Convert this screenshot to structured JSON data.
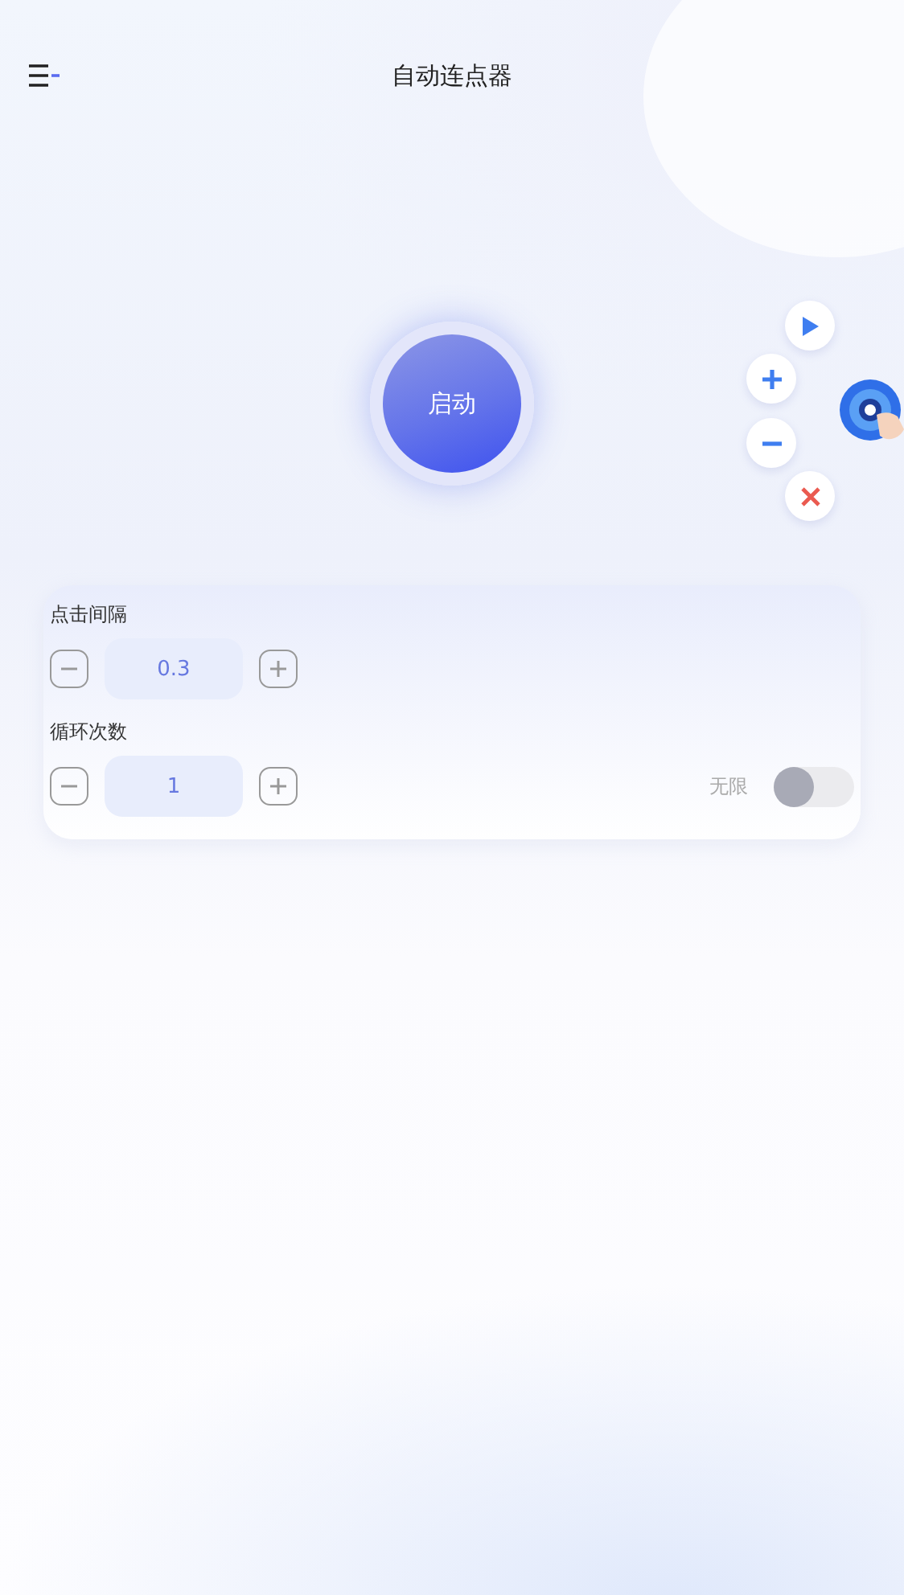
{
  "header": {
    "title": "自动连点器"
  },
  "start_button": {
    "label": "启动"
  },
  "settings": [
    {
      "label": "点击间隔",
      "value": "0.3"
    },
    {
      "label": "循环次数",
      "value": "1",
      "toggle": {
        "label": "无限",
        "on": false
      }
    }
  ]
}
